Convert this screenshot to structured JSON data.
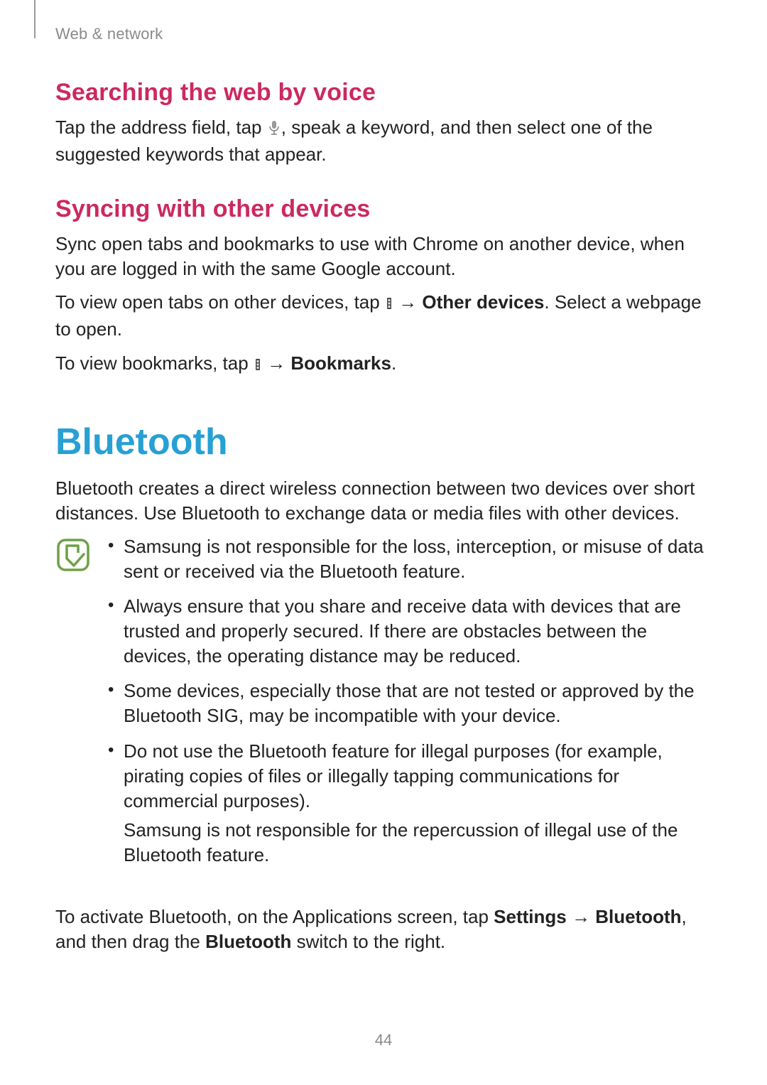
{
  "runningHead": "Web & network",
  "sec1": {
    "title": "Searching the web by voice",
    "p1a": "Tap the address field, tap ",
    "p1b": ", speak a keyword, and then select one of the suggested keywords that appear."
  },
  "sec2": {
    "title": "Syncing with other devices",
    "p1": "Sync open tabs and bookmarks to use with Chrome on another device, when you are logged in with the same Google account.",
    "p2a": "To view open tabs on other devices, tap ",
    "arrow": " → ",
    "p2b": "Other devices",
    "p2c": ". Select a webpage to open.",
    "p3a": "To view bookmarks, tap ",
    "p3b": "Bookmarks",
    "p3c": "."
  },
  "sec3": {
    "title": "Bluetooth",
    "p1": "Bluetooth creates a direct wireless connection between two devices over short distances. Use Bluetooth to exchange data or media files with other devices.",
    "notes": [
      "Samsung is not responsible for the loss, interception, or misuse of data sent or received via the Bluetooth feature.",
      "Always ensure that you share and receive data with devices that are trusted and properly secured. If there are obstacles between the devices, the operating distance may be reduced.",
      "Some devices, especially those that are not tested or approved by the Bluetooth SIG, may be incompatible with your device."
    ],
    "note4a": "Do not use the Bluetooth feature for illegal purposes (for example, pirating copies of files or illegally tapping communications for commercial purposes).",
    "note4b": "Samsung is not responsible for the repercussion of illegal use of the Bluetooth feature.",
    "p2a": "To activate Bluetooth, on the Applications screen, tap ",
    "p2b": "Settings",
    "p2c": "Bluetooth",
    "p2d": ", and then drag the ",
    "p2e": "Bluetooth",
    "p2f": " switch to the right."
  },
  "pageNumber": "44",
  "icons": {
    "mic": "mic-icon",
    "menu": "overflow-menu-icon",
    "note": "note-icon"
  }
}
